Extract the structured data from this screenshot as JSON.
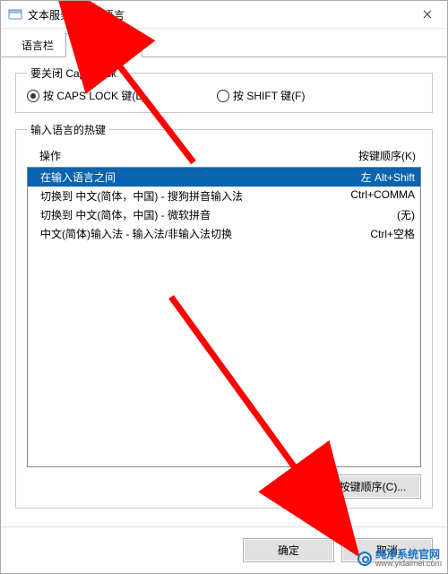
{
  "window": {
    "title": "文本服务和输入语言"
  },
  "tabs": [
    {
      "label": "语言栏",
      "active": false
    },
    {
      "label": "高级键设置",
      "active": true
    }
  ],
  "capslock_group": {
    "legend": "要关闭 Caps Lock",
    "options": [
      {
        "label": "按 CAPS LOCK 键(L)",
        "checked": true
      },
      {
        "label": "按 SHIFT 键(F)",
        "checked": false
      }
    ]
  },
  "hotkey_group": {
    "legend": "输入语言的热键",
    "col_action": "操作",
    "col_keys": "按键顺序(K)",
    "rows": [
      {
        "action": "在输入语言之间",
        "keys": "左 Alt+Shift",
        "selected": true
      },
      {
        "action": "切换到 中文(简体，中国) - 搜狗拼音输入法",
        "keys": "Ctrl+COMMA",
        "selected": false
      },
      {
        "action": "切换到 中文(简体，中国) - 微软拼音",
        "keys": "(无)",
        "selected": false
      },
      {
        "action": "中文(简体)输入法 - 输入法/非输入法切换",
        "keys": "Ctrl+空格",
        "selected": false
      }
    ],
    "change_button": "更改按键顺序(C)..."
  },
  "footer": {
    "ok": "确定",
    "cancel": "取消"
  },
  "watermark": {
    "top": "纯净系统官网",
    "bottom": "www.yidaimei.com"
  },
  "annotations": {
    "arrows_color": "#ff0000"
  }
}
